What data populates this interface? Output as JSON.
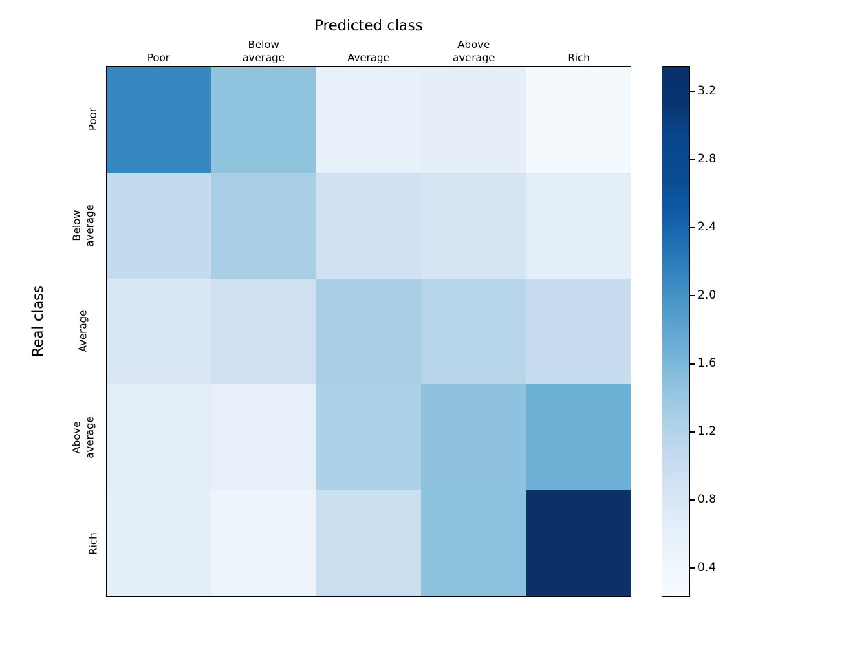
{
  "figure": {
    "title": "Predicted class",
    "ylabel": "Real class",
    "background": "#ffffff"
  },
  "colors": {
    "axis_line": "#000000",
    "text": "#000000",
    "cmap_low": "#f7fbff",
    "cmap_high": "#08306b"
  },
  "chart_data": {
    "type": "heatmap",
    "title": "Predicted class",
    "xlabel": "Predicted class",
    "ylabel": "Real class",
    "x_categories": [
      "Poor",
      "Below average",
      "Average",
      "Above average",
      "Rich"
    ],
    "y_categories": [
      "Poor",
      "Below average",
      "Average",
      "Above average",
      "Rich"
    ],
    "colormap": "Blues",
    "vmin": 0.23,
    "vmax": 3.35,
    "colorbar": {
      "position": "right",
      "ticks": [
        0.4,
        0.8,
        1.2,
        1.6,
        2.0,
        2.4,
        2.8,
        3.2
      ],
      "tick_labels": [
        "0.4",
        "0.8",
        "1.2",
        "1.6",
        "2.0",
        "2.4",
        "2.8",
        "3.2"
      ]
    },
    "grid": false,
    "rows": [
      {
        "label": "Poor",
        "values": [
          2.2,
          1.45,
          0.48,
          0.45,
          0.32
        ]
      },
      {
        "label": "Below average",
        "values": [
          0.95,
          1.25,
          0.8,
          0.7,
          0.52
        ]
      },
      {
        "label": "Average",
        "values": [
          0.72,
          0.82,
          1.3,
          1.15,
          0.95
        ]
      },
      {
        "label": "Above average",
        "values": [
          0.5,
          0.47,
          1.2,
          1.55,
          1.8
        ]
      },
      {
        "label": "Rich",
        "values": [
          0.55,
          0.36,
          0.88,
          1.6,
          3.3
        ]
      }
    ],
    "cell_colors": [
      [
        "#3787c0",
        "#8fc4de",
        "#e8f1f9",
        "#e6eff8",
        "#f4f9fd"
      ],
      [
        "#c4daed",
        "#a9cfe6",
        "#cfe1f2",
        "#d6e5f4",
        "#e4eef8"
      ],
      [
        "#d9e7f5",
        "#d0e1f2",
        "#a8cfe5",
        "#b6d5e9",
        "#c7dcef"
      ],
      [
        "#e4eef8",
        "#e7f0f9",
        "#acd0e6",
        "#8dc1dd",
        "#6cb0d6"
      ],
      [
        "#e5eff8",
        "#eef4fb",
        "#ccdff1",
        "#8dc3de",
        "#0b3167"
      ]
    ]
  }
}
